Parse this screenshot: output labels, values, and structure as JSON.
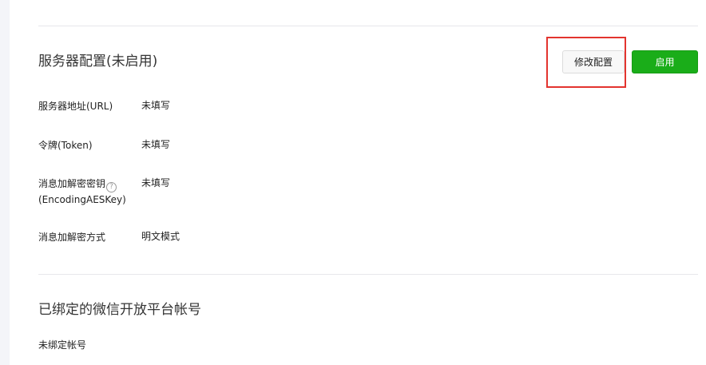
{
  "server_config": {
    "title": "服务器配置(未启用)",
    "edit_label": "修改配置",
    "enable_label": "启用",
    "rows": [
      {
        "label": "服务器地址(URL)",
        "value": "未填写"
      },
      {
        "label": "令牌(Token)",
        "value": "未填写"
      },
      {
        "label_line1": "消息加解密密钥",
        "label_line2": "(EncodingAESKey)",
        "help_icon": "?",
        "value": "未填写"
      },
      {
        "label": "消息加解密方式",
        "value": "明文模式"
      }
    ]
  },
  "bound_accounts": {
    "title": "已绑定的微信开放平台帐号",
    "empty_text": "未绑定帐号"
  },
  "colors": {
    "primary_green": "#1aad19",
    "highlight_red": "#e3342f"
  }
}
